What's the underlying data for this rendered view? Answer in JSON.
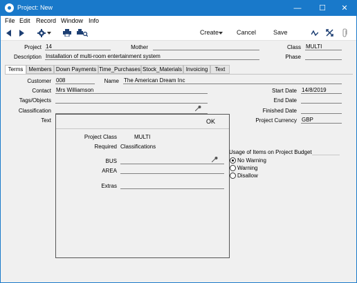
{
  "window": {
    "title": "Project: New",
    "minimize_glyph": "—",
    "maximize_glyph": "☐",
    "close_glyph": "✕"
  },
  "menubar": {
    "items": [
      "File",
      "Edit",
      "Record",
      "Window",
      "Info"
    ]
  },
  "toolbar": {
    "create_label": "Create",
    "cancel_label": "Cancel",
    "save_label": "Save"
  },
  "header": {
    "project_label": "Project",
    "project_value": "14",
    "mother_label": "Mother",
    "mother_value": "",
    "class_label": "Class",
    "class_value": "MULTI",
    "description_label": "Description",
    "description_value": "Installation of multi-room entertainment system",
    "phase_label": "Phase",
    "phase_value": ""
  },
  "tabs": [
    "Terms",
    "Members",
    "Down Payments",
    "Time_Purchases",
    "Stock_Materials",
    "Invoicing",
    "Text"
  ],
  "terms": {
    "customer_label": "Customer",
    "customer_value": "008",
    "name_label": "Name",
    "name_value": "The American Dream Inc",
    "contact_label": "Contact",
    "contact_value": "Mrs Williamson",
    "tags_label": "Tags/Objects",
    "tags_value": "",
    "classification_label": "Classification",
    "classification_value": "",
    "text_label": "Text",
    "start_date_label": "Start Date",
    "start_date_value": "14/8/2019",
    "end_date_label": "End Date",
    "end_date_value": "",
    "finished_date_label": "Finished Date",
    "finished_date_value": "",
    "currency_label": "Project Currency",
    "currency_value": "GBP",
    "usage_title": "Usage of Items on Project Budget",
    "usage_options": [
      "No Warning",
      "Warning",
      "Disallow"
    ],
    "usage_selected": "No Warning"
  },
  "popup": {
    "ok_label": "OK",
    "project_class_label": "Project Class",
    "project_class_value": "MULTI",
    "required_label": "Required",
    "required_value": "Classifications",
    "bus_label": "BUS",
    "bus_value": "",
    "area_label": "AREA",
    "area_value": "",
    "extras_label": "Extras",
    "extras_value": ""
  },
  "colors": {
    "titlebar": "#1979ca",
    "window_bg": "#f0f0f0",
    "accent": "#1979ca"
  },
  "icons": [
    "app-icon",
    "back-arrow-icon",
    "forward-arrow-icon",
    "gear-icon",
    "print-icon",
    "print-preview-icon",
    "caret-down-icon",
    "activity-icon",
    "expand-icon",
    "paperclip-icon",
    "paste-special-icon"
  ]
}
